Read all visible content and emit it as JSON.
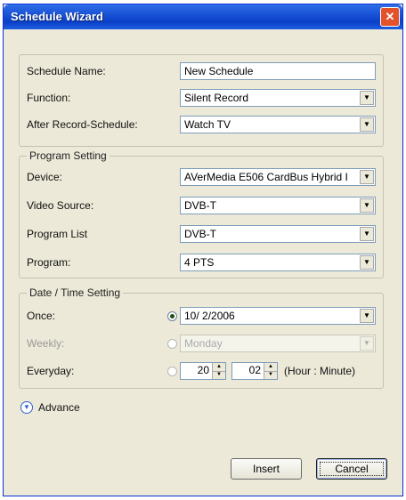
{
  "window": {
    "title": "Schedule Wizard",
    "close_glyph": "✕"
  },
  "basic": {
    "schedule_name_label": "Schedule Name:",
    "schedule_name_value": "New Schedule",
    "function_label": "Function:",
    "function_value": "Silent Record",
    "after_label": "After Record-Schedule:",
    "after_value": "Watch TV"
  },
  "program": {
    "legend": "Program Setting",
    "device_label": "Device:",
    "device_value": "AVerMedia E506 CardBus Hybrid I",
    "video_source_label": "Video Source:",
    "video_source_value": "DVB-T",
    "program_list_label": "Program List",
    "program_list_value": "DVB-T",
    "program_label": "Program:",
    "program_value": "4 PTS"
  },
  "datetime": {
    "legend": "Date / Time Setting",
    "once_label": "Once:",
    "once_value": "10/ 2/2006",
    "weekly_label": "Weekly:",
    "weekly_value": "Monday",
    "everyday_label": "Everyday:",
    "hour_value": "20",
    "minute_value": "02",
    "hour_minute_label": "(Hour : Minute)"
  },
  "advance_label": "Advance",
  "buttons": {
    "insert": "Insert",
    "cancel": "Cancel"
  },
  "icons": {
    "dropdown": "▼",
    "spin_up": "▲",
    "spin_down": "▼",
    "expand": "▼"
  }
}
